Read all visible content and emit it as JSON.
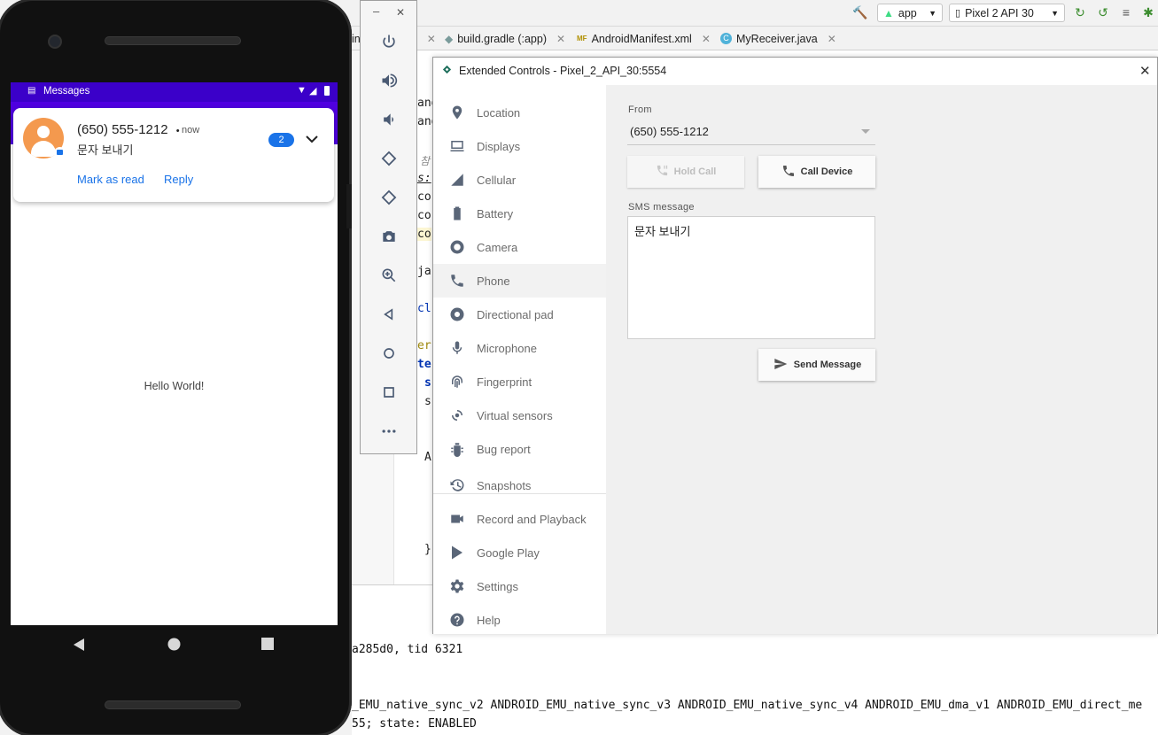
{
  "ide": {
    "run_config": "app",
    "device_selector": "Pixel 2 API 30",
    "tabs": [
      {
        "label": "in"
      },
      {
        "label": "build.gradle (:app)"
      },
      {
        "label": "AndroidManifest.xml"
      },
      {
        "label": "MyReceiver.java"
      }
    ],
    "code_fragments": [
      "and",
      "and",
      "참",
      "s:",
      "co",
      "co",
      "co",
      "ja",
      "cl",
      "er",
      "te",
      "s",
      "s",
      "A",
      "}"
    ],
    "console_lines": [
      "a285d0, tid 6321",
      "_EMU_native_sync_v2 ANDROID_EMU_native_sync_v3 ANDROID_EMU_native_sync_v4 ANDROID_EMU_dma_v1 ANDROID_EMU_direct_me",
      "55; state: ENABLED"
    ]
  },
  "emulator_toolbar": {
    "minimize": "–",
    "close": "✕"
  },
  "phone": {
    "status_app": "Messages",
    "notification": {
      "title": "(650) 555-1212",
      "separator": "•",
      "time": "now",
      "body": "문자 보내기",
      "count": "2",
      "actions": [
        "Mark as read",
        "Reply"
      ]
    },
    "hello": "Hello World!"
  },
  "extended_controls": {
    "title": "Extended Controls - Pixel_2_API_30:5554",
    "close": "✕",
    "nav": [
      {
        "label": "Location",
        "icon": "location-icon"
      },
      {
        "label": "Displays",
        "icon": "displays-icon"
      },
      {
        "label": "Cellular",
        "icon": "cellular-icon"
      },
      {
        "label": "Battery",
        "icon": "battery-icon"
      },
      {
        "label": "Camera",
        "icon": "camera-icon"
      },
      {
        "label": "Phone",
        "icon": "phone-icon",
        "active": true
      },
      {
        "label": "Directional pad",
        "icon": "dpad-icon"
      },
      {
        "label": "Microphone",
        "icon": "microphone-icon"
      },
      {
        "label": "Fingerprint",
        "icon": "fingerprint-icon"
      },
      {
        "label": "Virtual sensors",
        "icon": "virtual-sensors-icon"
      },
      {
        "label": "Bug report",
        "icon": "bug-icon"
      },
      {
        "label": "Snapshots",
        "icon": "snapshots-icon"
      },
      {
        "label": "Record and Playback",
        "icon": "record-icon"
      },
      {
        "label": "Google Play",
        "icon": "google-play-icon"
      },
      {
        "label": "Settings",
        "icon": "settings-icon"
      },
      {
        "label": "Help",
        "icon": "help-icon"
      }
    ],
    "phone_panel": {
      "from_label": "From",
      "from_value": "(650) 555-1212",
      "hold_call": "Hold Call",
      "call_device": "Call Device",
      "sms_label": "SMS message",
      "sms_value": "문자 보내기",
      "send_message": "Send Message"
    }
  },
  "colors": {
    "status_bar": "#3b00c9",
    "app_bar": "#4f00e0",
    "accent_blue": "#1a73e8",
    "avatar": "#f4994e"
  }
}
